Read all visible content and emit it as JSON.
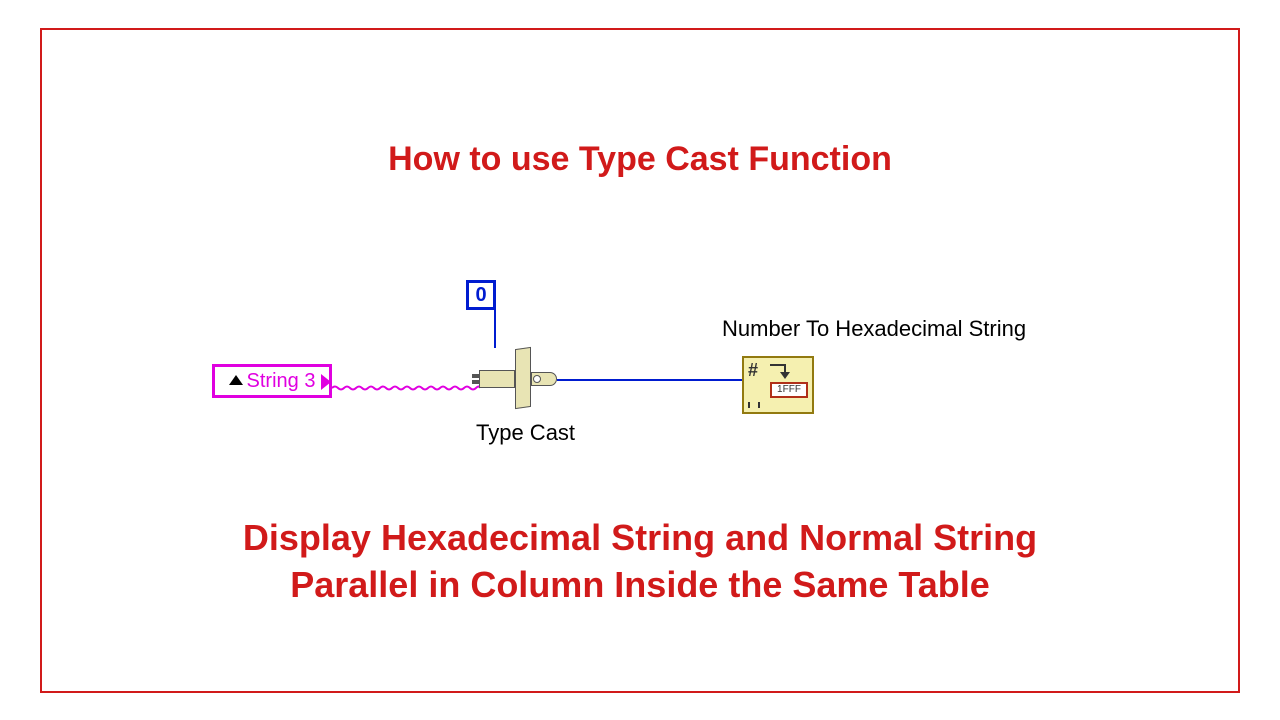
{
  "title": "How to use Type Cast  Function",
  "subtitle_line1": "Display Hexadecimal String and Normal String",
  "subtitle_line2": "Parallel in Column Inside the Same Table",
  "diagram": {
    "string_control_label": "String 3",
    "constant_value": "0",
    "typecast_label": "Type Cast",
    "hex_node_label": "Number To Hexadecimal String",
    "hex_node_inner": "1FFF"
  },
  "colors": {
    "accent_red": "#d11a1a",
    "string_pink": "#e000e0",
    "numeric_blue": "#001cd0",
    "node_fill": "#f5f0b0"
  }
}
